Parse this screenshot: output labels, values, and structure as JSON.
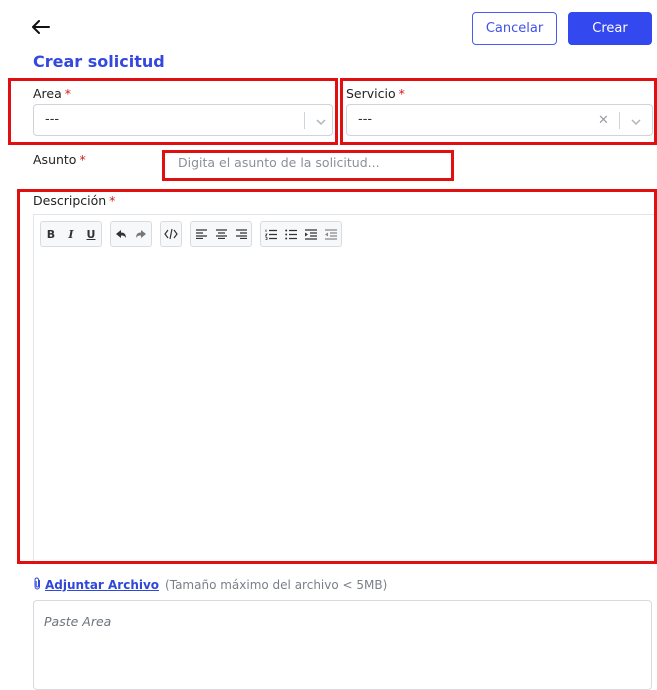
{
  "header": {
    "cancel_label": "Cancelar",
    "create_label": "Crear",
    "page_title": "Crear solicitud"
  },
  "form": {
    "area": {
      "label": "Area",
      "required_mark": "*",
      "value": "---"
    },
    "servicio": {
      "label": "Servicio",
      "required_mark": "*",
      "value": "---"
    },
    "asunto": {
      "label": "Asunto",
      "required_mark": "*",
      "placeholder": "Digita el asunto de la solicitud..."
    },
    "descripcion": {
      "label": "Descripción",
      "required_mark": "*"
    }
  },
  "toolbar": {
    "groups": [
      [
        "bold",
        "italic",
        "underline"
      ],
      [
        "undo",
        "redo"
      ],
      [
        "code"
      ],
      [
        "align-left",
        "align-center",
        "align-right"
      ],
      [
        "ordered-list",
        "unordered-list",
        "indent",
        "outdent"
      ]
    ],
    "bold_label": "B",
    "italic_label": "I",
    "underline_label": "U"
  },
  "attachment": {
    "link_label": "Adjuntar Archivo",
    "note": "(Tamaño máximo del archivo < 5MB)",
    "paste_placeholder": "Paste Area"
  },
  "colors": {
    "accent": "#3348ee",
    "title": "#3448e0",
    "required": "#d11a1a",
    "highlight": "#e01010"
  }
}
